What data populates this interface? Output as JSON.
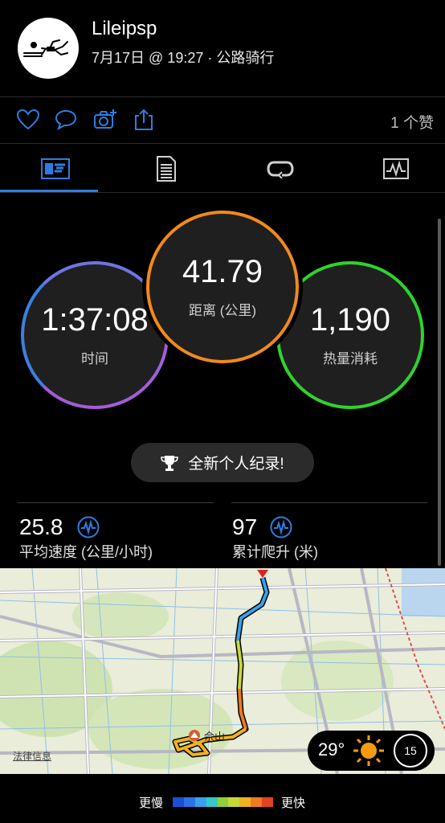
{
  "header": {
    "username": "Lileipsp",
    "subtitle": "7月17日 @ 19:27 · 公路骑行"
  },
  "actions": {
    "likes": "1 个赞",
    "accent": "#2f7de1"
  },
  "tabs": [
    {
      "name": "overview",
      "active": true
    },
    {
      "name": "details",
      "active": false
    },
    {
      "name": "laps",
      "active": false
    },
    {
      "name": "charts",
      "active": false
    }
  ],
  "stats": {
    "time": {
      "value": "1:37:08",
      "label": "时间",
      "color": "#7b6ae0"
    },
    "distance": {
      "value": "41.79",
      "label": "距离 (公里)",
      "color": "#f08a1c"
    },
    "calories": {
      "value": "1,190",
      "label": "热量消耗",
      "color": "#2ed32e"
    }
  },
  "record": {
    "label": "全新个人纪录!"
  },
  "metrics": {
    "avg_speed": {
      "value": "25.8",
      "label": "平均速度 (公里/小时)"
    },
    "ascent": {
      "value": "97",
      "label": "累计爬升 (米)"
    }
  },
  "map": {
    "place_label": "佘山",
    "legal": "法律信息",
    "temperature": "29°",
    "wind_speed": "15"
  },
  "legend": {
    "slow": "更慢",
    "fast": "更快",
    "colors": [
      "#1a4fd6",
      "#2a72e6",
      "#3aa0e8",
      "#36c7c9",
      "#8fd13a",
      "#c8d83a",
      "#f0b020",
      "#f07a20",
      "#e04420"
    ]
  }
}
